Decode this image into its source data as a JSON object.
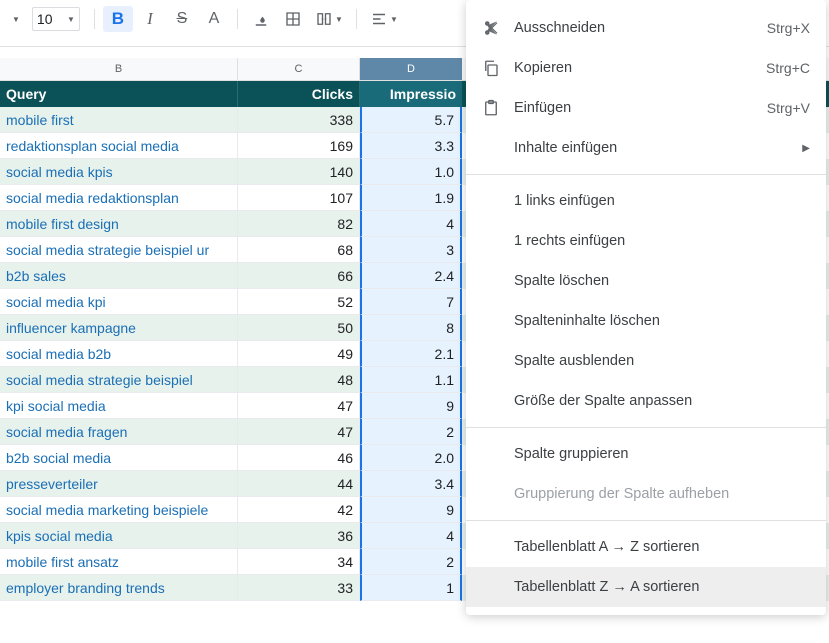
{
  "toolbar": {
    "font_size": "10"
  },
  "headers": {
    "b": "Query",
    "c": "Clicks",
    "d": "Impressio"
  },
  "col_labels": {
    "b": "B",
    "c": "C",
    "d": "D"
  },
  "rows": [
    {
      "q": "mobile first",
      "c": "338",
      "i": "5.7"
    },
    {
      "q": "redaktionsplan social media",
      "c": "169",
      "i": "3.3"
    },
    {
      "q": "social media kpis",
      "c": "140",
      "i": "1.0"
    },
    {
      "q": "social media redaktionsplan",
      "c": "107",
      "i": "1.9"
    },
    {
      "q": "mobile first design",
      "c": "82",
      "i": "4"
    },
    {
      "q": "social media strategie beispiel ur",
      "c": "68",
      "i": "3"
    },
    {
      "q": "b2b sales",
      "c": "66",
      "i": "2.4"
    },
    {
      "q": "social media kpi",
      "c": "52",
      "i": "7"
    },
    {
      "q": "influencer kampagne",
      "c": "50",
      "i": "8"
    },
    {
      "q": "social media b2b",
      "c": "49",
      "i": "2.1"
    },
    {
      "q": "social media strategie beispiel",
      "c": "48",
      "i": "1.1"
    },
    {
      "q": "kpi social media",
      "c": "47",
      "i": "9"
    },
    {
      "q": "social media fragen",
      "c": "47",
      "i": "2"
    },
    {
      "q": "b2b social media",
      "c": "46",
      "i": "2.0"
    },
    {
      "q": "presseverteiler",
      "c": "44",
      "i": "3.4"
    },
    {
      "q": "social media marketing beispiele",
      "c": "42",
      "i": "9"
    },
    {
      "q": "kpis social media",
      "c": "36",
      "i": "4"
    },
    {
      "q": "mobile first ansatz",
      "c": "34",
      "i": "2"
    },
    {
      "q": "employer branding trends",
      "c": "33",
      "i": "1"
    }
  ],
  "menu": {
    "cut": "Ausschneiden",
    "cut_sc": "Strg+X",
    "copy": "Kopieren",
    "copy_sc": "Strg+C",
    "paste": "Einfügen",
    "paste_sc": "Strg+V",
    "paste_special": "Inhalte einfügen",
    "insert_left": "1 links einfügen",
    "insert_right": "1 rechts einfügen",
    "delete_col": "Spalte löschen",
    "clear_col": "Spalteninhalte löschen",
    "hide_col": "Spalte ausblenden",
    "resize_col": "Größe der Spalte anpassen",
    "group_col": "Spalte gruppieren",
    "ungroup_col": "Gruppierung der Spalte aufheben",
    "sort_az": "Tabellenblatt A → Z sortieren",
    "sort_za": "Tabellenblatt Z → A sortieren"
  }
}
